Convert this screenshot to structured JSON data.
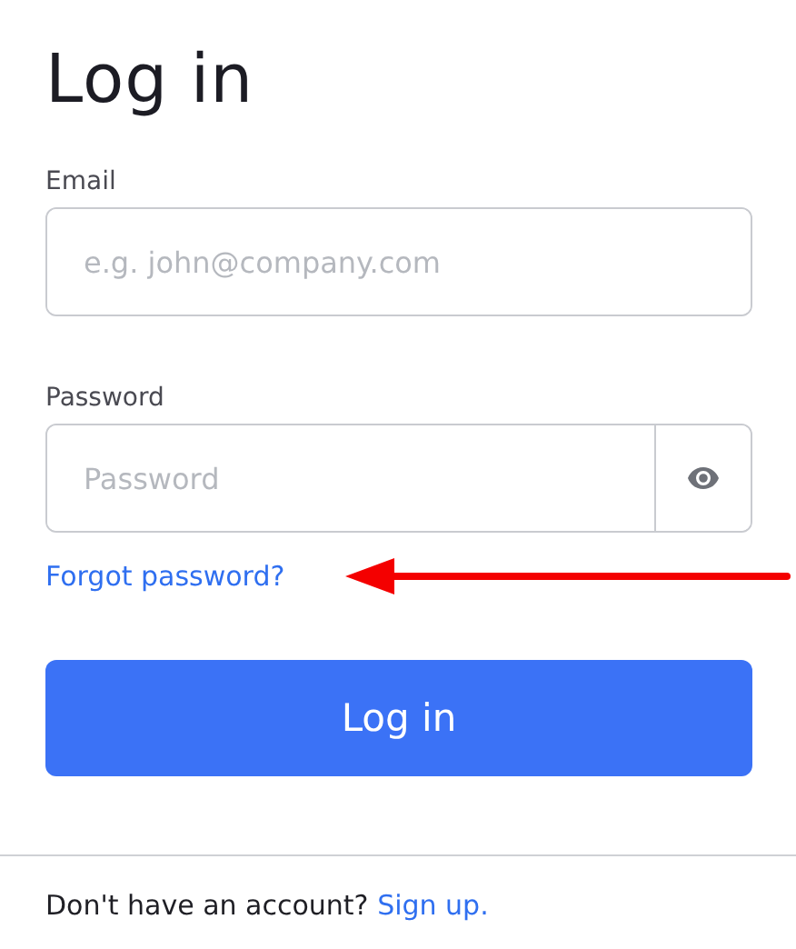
{
  "title": "Log in",
  "fields": [
    {
      "kind": "text",
      "label": "Email",
      "placeholder": "e.g. john@company.com"
    },
    {
      "kind": "password",
      "label": "Password",
      "placeholder": "Password"
    }
  ],
  "forgot_link": "Forgot password?",
  "annotation": {
    "kind": "arrow"
  },
  "submit_button": "Log in",
  "footer": {
    "text": "Don't have an account?",
    "link": "Sign up."
  }
}
